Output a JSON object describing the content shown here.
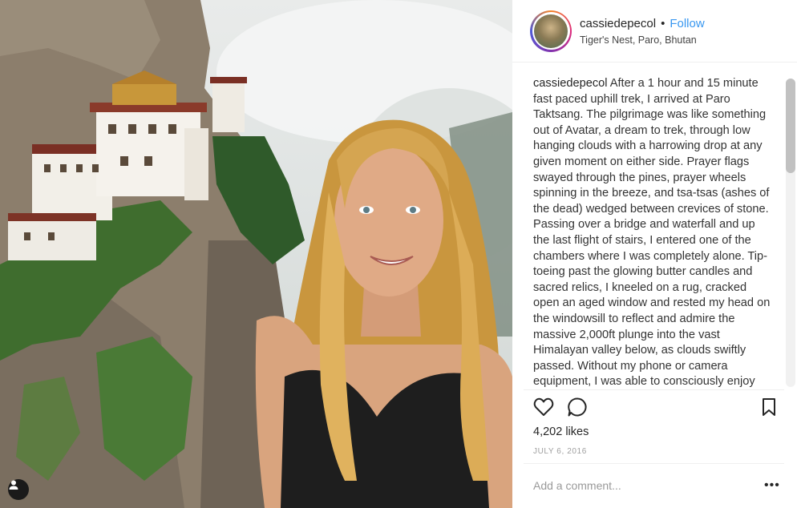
{
  "post": {
    "username": "cassiedepecol",
    "separator": "•",
    "follow_label": "Follow",
    "location": "Tiger's Nest, Paro, Bhutan",
    "caption_user": "cassiedepecol",
    "caption_text": "After a 1 hour and 15 minute fast paced uphill trek, I arrived at Paro Taktsang. The pilgrimage was like something out of Avatar, a dream to trek, through low hanging clouds with a harrowing drop at any given moment on either side. Prayer flags swayed through the pines, prayer wheels spinning in the breeze, and tsa-tsas (ashes of the dead) wedged between crevices of stone. Passing over a bridge and waterfall and up the last flight of stairs, I entered one of the chambers where I was completely alone. Tip-toeing past the glowing butter candles and sacred relics, I kneeled on a rug, cracked open an aged window and rested my head on the windowsill to reflect and admire the massive 2,000ft plunge into the vast Himalayan valley below, as clouds swiftly passed. Without my phone or camera equipment, I was able to consciously enjoy",
    "likes": "4,202 likes",
    "date": "JULY 6, 2016"
  },
  "comment": {
    "placeholder": "Add a comment..."
  },
  "more_label": "•••",
  "icons": {
    "like": "heart-icon",
    "comment": "comment-icon",
    "save": "bookmark-icon",
    "tag": "user-tag-icon"
  },
  "colors": {
    "follow": "#3897f0",
    "text": "#262626",
    "muted": "#999999"
  }
}
